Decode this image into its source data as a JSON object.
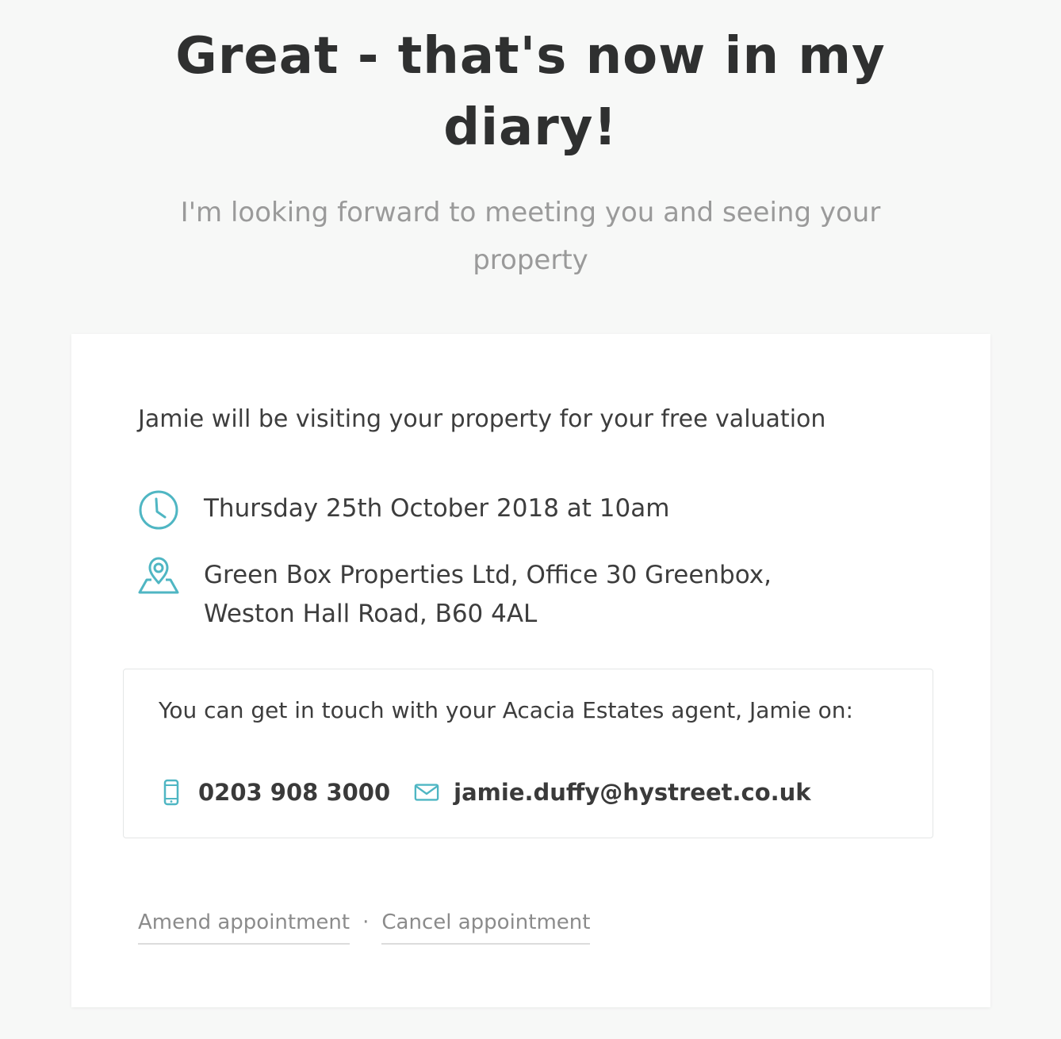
{
  "header": {
    "title": "Great - that's now in my diary!",
    "subtitle": "I'm looking forward to meeting you and seeing your property"
  },
  "appointment": {
    "intro": "Jamie will be visiting your property for your free valuation",
    "datetime": "Thursday 25th October 2018 at 10am",
    "location": "Green Box Properties Ltd, Office 30 Greenbox, Weston Hall Road, B60 4AL"
  },
  "contact": {
    "text": "You can get in touch with your Acacia Estates agent, Jamie on:",
    "phone": "0203 908 3000",
    "email": "jamie.duffy@hystreet.co.uk"
  },
  "actions": {
    "amend_label": "Amend appointment",
    "separator": "·",
    "cancel_label": "Cancel appointment"
  },
  "colors": {
    "accent": "#4fb6c3",
    "background": "#f7f8f7",
    "card": "#ffffff"
  },
  "icons": {
    "datetime": "clock-icon",
    "location": "map-pin-icon",
    "phone": "mobile-phone-icon",
    "email": "envelope-icon"
  }
}
